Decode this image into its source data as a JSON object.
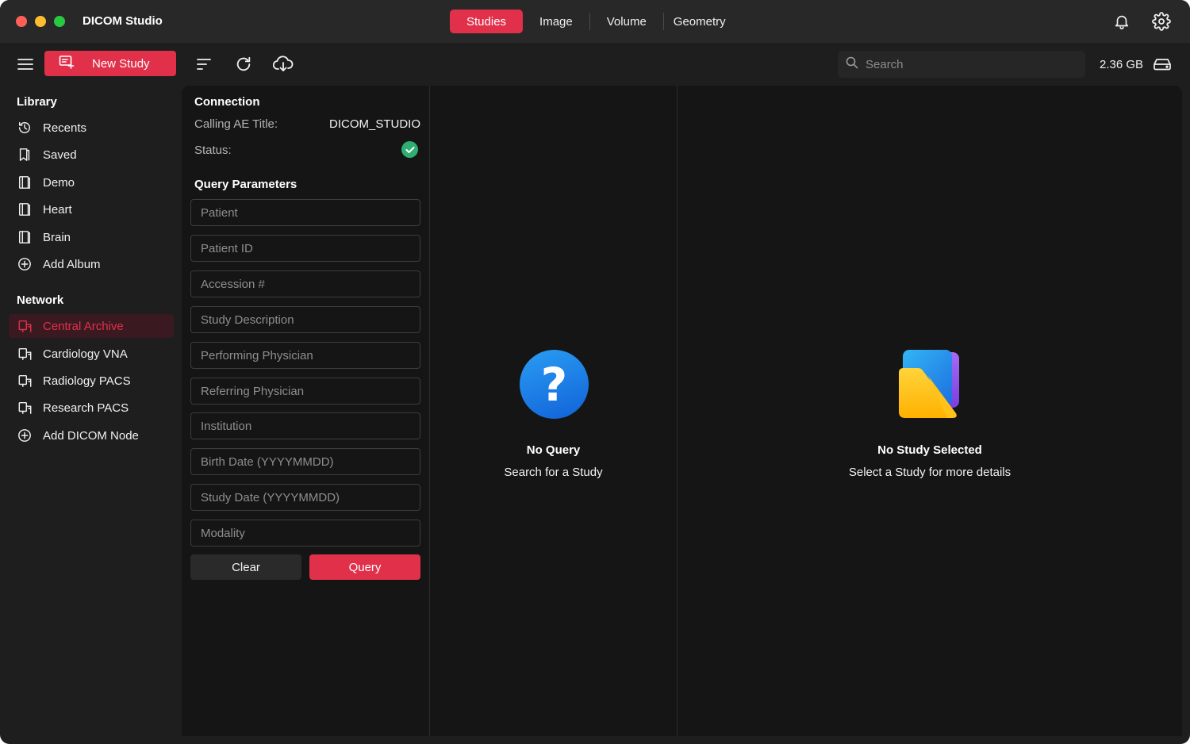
{
  "app": {
    "title": "DICOM Studio"
  },
  "tabs": [
    {
      "label": "Studies",
      "active": true
    },
    {
      "label": "Image",
      "active": false
    },
    {
      "label": "Volume",
      "active": false
    },
    {
      "label": "Geometry",
      "active": false
    }
  ],
  "toolbar": {
    "new_study_label": "New Study",
    "search_placeholder": "Search",
    "storage": "2.36 GB"
  },
  "sidebar": {
    "library_title": "Library",
    "library_items": [
      {
        "label": "Recents",
        "icon": "clock-icon"
      },
      {
        "label": "Saved",
        "icon": "bookmark-icon"
      },
      {
        "label": "Demo",
        "icon": "album-icon"
      },
      {
        "label": "Heart",
        "icon": "album-icon"
      },
      {
        "label": "Brain",
        "icon": "album-icon"
      },
      {
        "label": "Add Album",
        "icon": "plus-circle-icon"
      }
    ],
    "network_title": "Network",
    "network_items": [
      {
        "label": "Central Archive",
        "icon": "network-node-icon",
        "active": true
      },
      {
        "label": "Cardiology VNA",
        "icon": "network-node-icon"
      },
      {
        "label": "Radiology PACS",
        "icon": "network-node-icon"
      },
      {
        "label": "Research PACS",
        "icon": "network-node-icon"
      },
      {
        "label": "Add DICOM Node",
        "icon": "plus-circle-icon"
      }
    ]
  },
  "query_panel": {
    "connection_title": "Connection",
    "calling_ae_label": "Calling AE Title:",
    "calling_ae_value": "DICOM_STUDIO",
    "status_label": "Status:",
    "status_state": "connected",
    "params_title": "Query Parameters",
    "fields": [
      {
        "placeholder": "Patient",
        "value": ""
      },
      {
        "placeholder": "Patient ID",
        "value": ""
      },
      {
        "placeholder": "Accession #",
        "value": ""
      },
      {
        "placeholder": "Study Description",
        "value": ""
      },
      {
        "placeholder": "Performing Physician",
        "value": ""
      },
      {
        "placeholder": "Referring Physician",
        "value": ""
      },
      {
        "placeholder": "Institution",
        "value": ""
      },
      {
        "placeholder": "Birth Date (YYYYMMDD)",
        "value": ""
      },
      {
        "placeholder": "Study Date (YYYYMMDD)",
        "value": ""
      },
      {
        "placeholder": "Modality",
        "value": ""
      }
    ],
    "clear_label": "Clear",
    "query_label": "Query"
  },
  "results": {
    "title": "No Query",
    "subtitle": "Search for a Study"
  },
  "details": {
    "title": "No Study Selected",
    "subtitle": "Select a Study for more details"
  },
  "colors": {
    "accent": "#e0304a",
    "status_ok": "#2fae72",
    "background": "#1e1e1e",
    "panel": "#151515"
  }
}
